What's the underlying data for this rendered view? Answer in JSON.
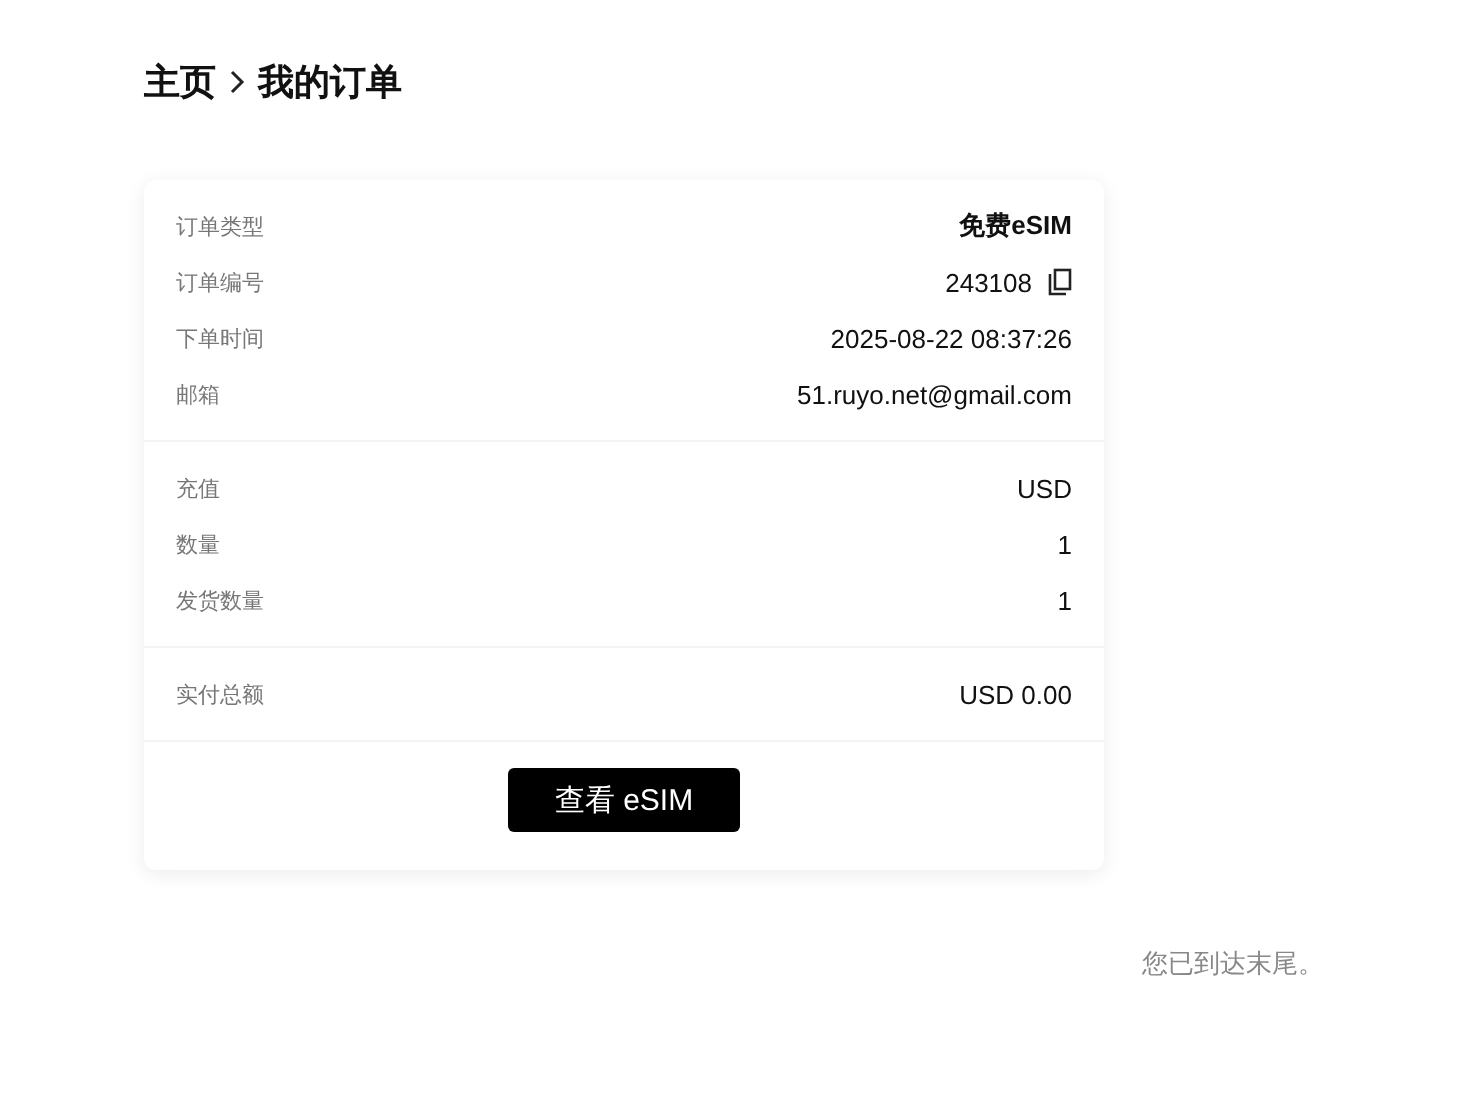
{
  "breadcrumb": [
    {
      "label": "主页"
    },
    {
      "label": "我的订单"
    }
  ],
  "sections": [
    {
      "rows": [
        {
          "label": "订单类型",
          "value": "免费eSIM",
          "copyable": false
        },
        {
          "label": "订单编号",
          "value": "243108",
          "copyable": true
        },
        {
          "label": "下单时间",
          "value": "2025-08-22 08:37:26",
          "copyable": false
        },
        {
          "label": "邮箱",
          "value": "51.ruyo.net@gmail.com",
          "copyable": false
        }
      ]
    },
    {
      "rows": [
        {
          "label": "充值",
          "value": "USD",
          "copyable": false
        },
        {
          "label": "数量",
          "value": "1",
          "copyable": false
        },
        {
          "label": "发货数量",
          "value": "1",
          "copyable": false
        }
      ]
    },
    {
      "rows": [
        {
          "label": "实付总额",
          "value": "USD 0.00",
          "copyable": false
        }
      ]
    }
  ],
  "button": "查看 eSIM",
  "end_note": "您已到达末尾。"
}
